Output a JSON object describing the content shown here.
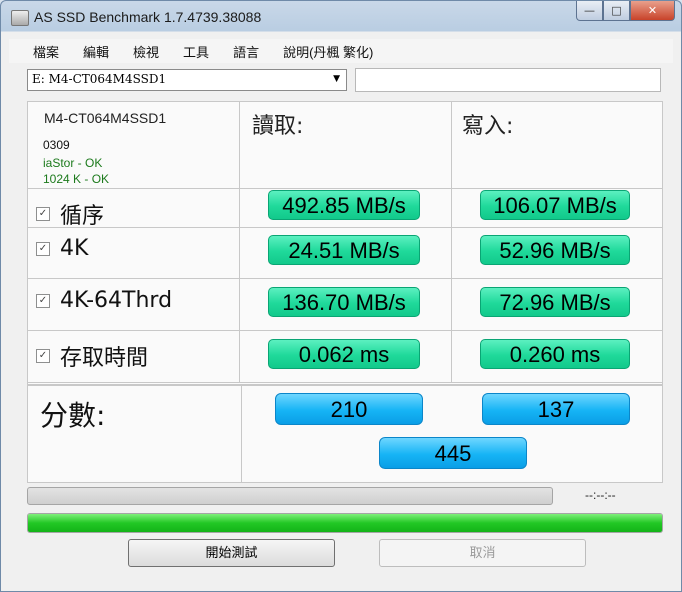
{
  "window": {
    "title": "AS SSD Benchmark 1.7.4739.38088"
  },
  "controls": {
    "minimize": "—",
    "maximize": "□",
    "close": "✕"
  },
  "menu": [
    "檔案",
    "編輯",
    "檢視",
    "工具",
    "語言",
    "說明(丹楓 繁化)"
  ],
  "drive": {
    "selected": "E: M4-CT064M4SSD1"
  },
  "info": {
    "model": "M4-CT064M4SSD1",
    "firmware": "0309",
    "driver_status": "iaStor - OK",
    "alignment_status": "1024 K - OK"
  },
  "headers": {
    "read": "讀取:",
    "write": "寫入:"
  },
  "rows": [
    {
      "label": "循序",
      "checked": true,
      "read": "492.85 MB/s",
      "write": "106.07 MB/s"
    },
    {
      "label": "4K",
      "checked": true,
      "read": "24.51 MB/s",
      "write": "52.96 MB/s"
    },
    {
      "label": "4K-64Thrd",
      "checked": true,
      "read": "136.70 MB/s",
      "write": "72.96 MB/s"
    },
    {
      "label": "存取時間",
      "checked": true,
      "read": "0.062 ms",
      "write": "0.260 ms"
    }
  ],
  "score": {
    "label": "分數:",
    "read": "210",
    "write": "137",
    "total": "445"
  },
  "progress": {
    "time": "--:--:--",
    "value": 0,
    "overall_value": 1.0
  },
  "buttons": {
    "start": "開始測試",
    "cancel": "取消"
  },
  "colors": {
    "result_green": "#1fd99a",
    "score_blue": "#16b4f5",
    "progress_green": "#22c825"
  }
}
